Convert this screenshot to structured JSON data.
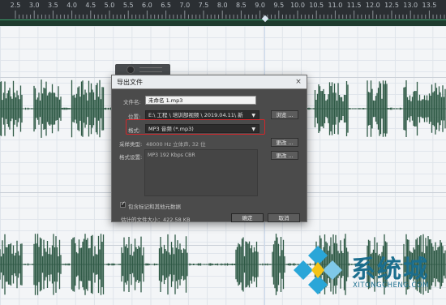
{
  "ruler": {
    "ticks": [
      "2.5",
      "3.0",
      "3.5",
      "4.0",
      "4.5",
      "5.0",
      "5.5",
      "6.0",
      "6.5",
      "7.0",
      "7.5",
      "8.0",
      "8.5",
      "9.0",
      "9.5",
      "10.0",
      "10.5",
      "11.0",
      "11.5",
      "12.0",
      "12.5",
      "13.0",
      "13.5"
    ]
  },
  "dialog": {
    "title": "导出文件",
    "close_label": "×",
    "filename_label": "文件名:",
    "filename_value": "未命名 1.mp3",
    "location_label": "位置:",
    "location_value": "E:\\ 工程 \\ 培训部视频 \\ 2019.04.11\\ 新",
    "browse_label": "浏览 ...",
    "format_label": "格式:",
    "format_value": "MP3 音频 (*.mp3)",
    "sample_type_label": "采样类型:",
    "sample_type_value": "48000 Hz 立体声, 32 位",
    "change_label_1": "更改 ...",
    "format_settings_label": "格式设置:",
    "format_settings_value": "MP3 192 Kbps CBR",
    "change_label_2": "更改 ...",
    "include_markers_label": "包含标记和其他元数据",
    "include_markers_checked": true,
    "estimated_size_label": "估计的文件大小：422.58 KB",
    "ok_label": "确定",
    "cancel_label": "取消",
    "highlight_color": "#d2272b"
  },
  "watermark": {
    "brand": "系统城",
    "url": "XITONGCHENG.COM",
    "color": "#1b6e8e"
  },
  "colors": {
    "ruler_bg": "#2b2f33",
    "waveform": "#2f5a46",
    "dialog_bg": "#4b4b4b"
  }
}
